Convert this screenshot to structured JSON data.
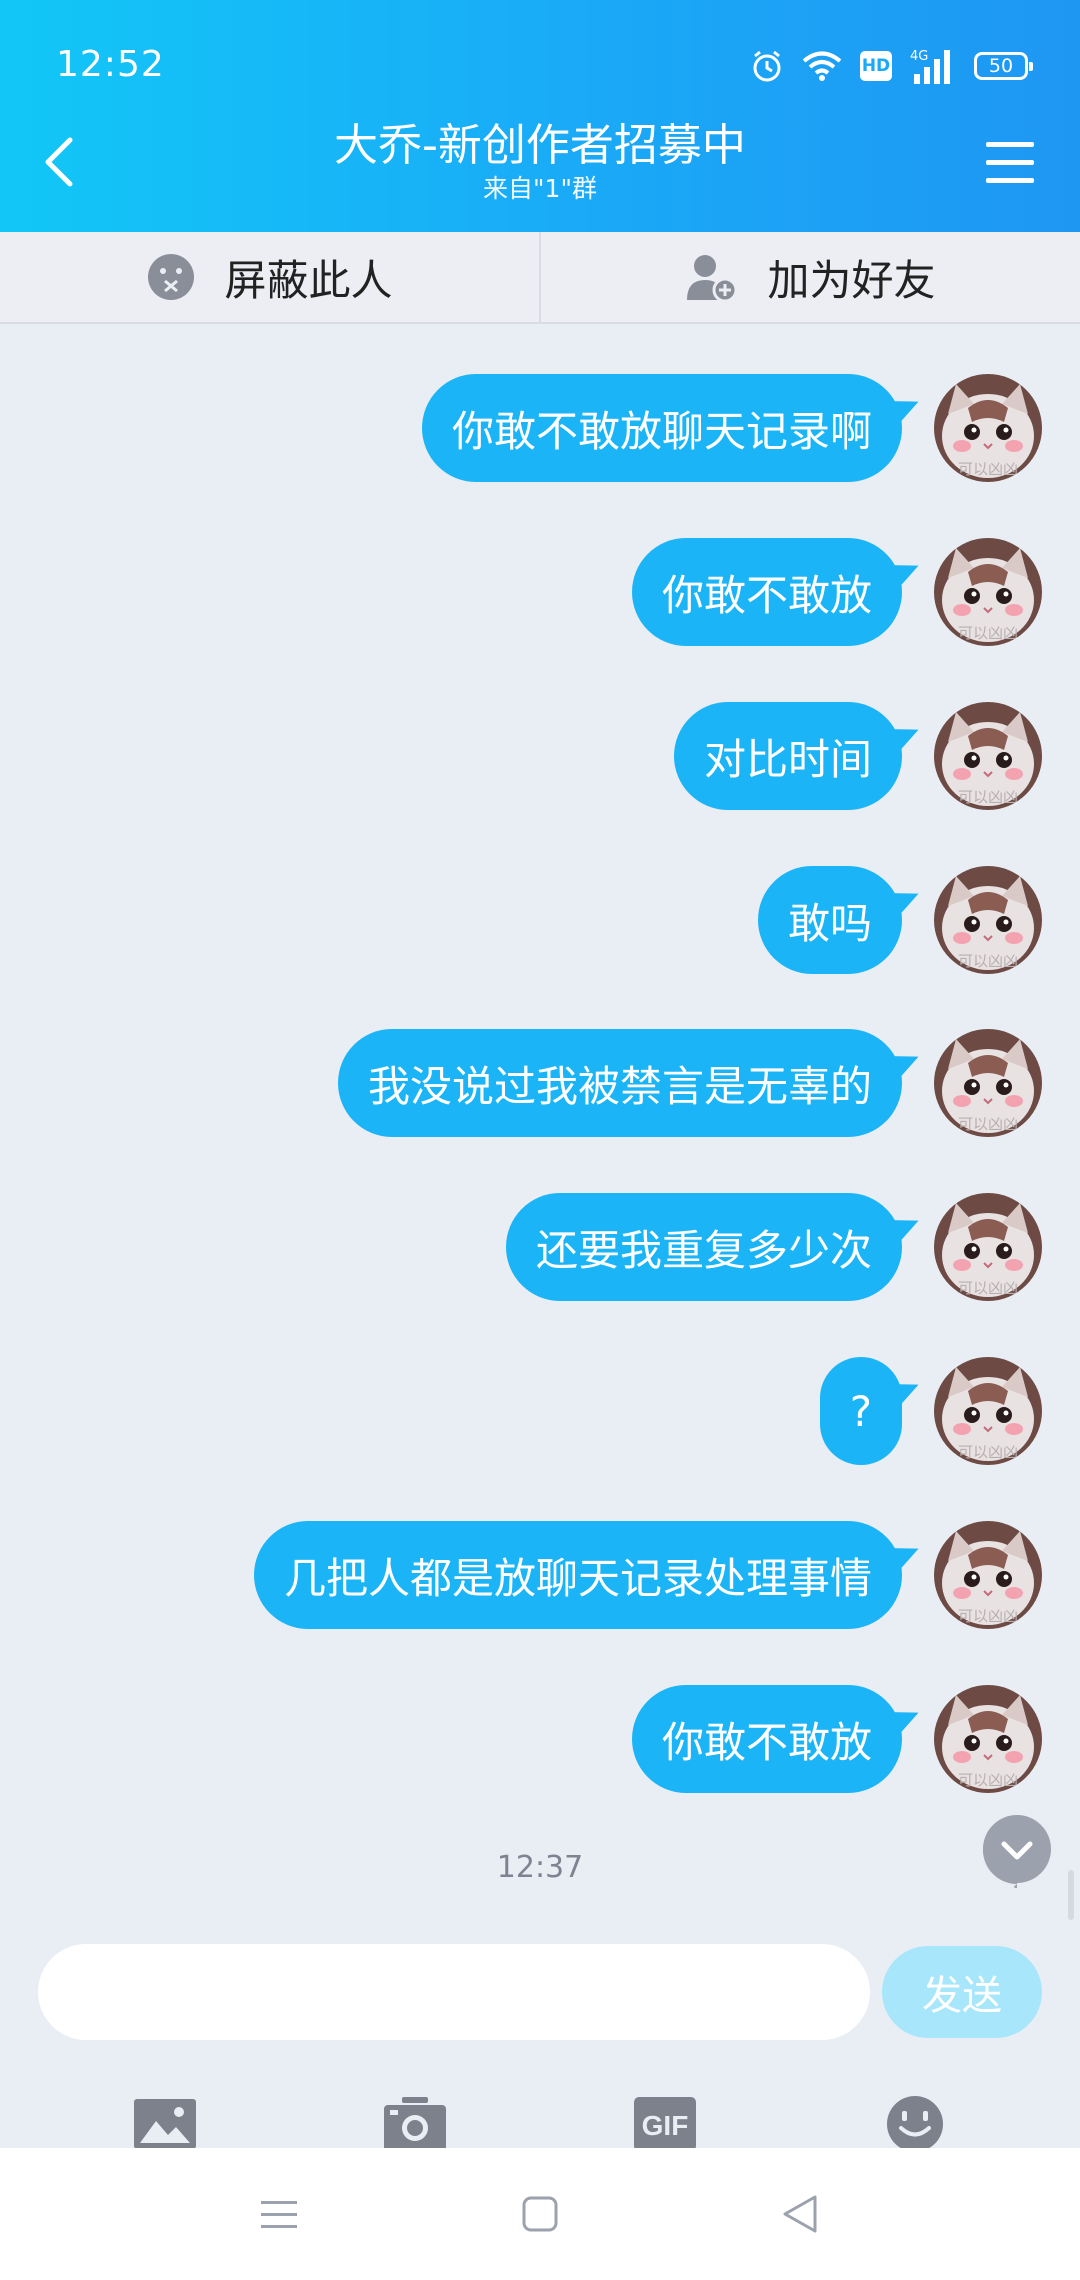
{
  "status_bar": {
    "time": "12:52",
    "hd": "HD",
    "network": "4G",
    "battery": "50"
  },
  "header": {
    "title": "大乔-新创作者招募中",
    "subtitle": "来自\"1\"群"
  },
  "actions": {
    "block": "屏蔽此人",
    "add_friend": "加为好友"
  },
  "messages": [
    {
      "text": "你敢不敢放聊天记录啊"
    },
    {
      "text": "你敢不敢放"
    },
    {
      "text": "对比时间"
    },
    {
      "text": "敢吗"
    },
    {
      "text": "我没说过我被禁言是无辜的"
    },
    {
      "text": "还要我重复多少次"
    },
    {
      "text": "?"
    },
    {
      "text": "几把人都是放聊天记录处理事情"
    },
    {
      "text": "你敢不敢放"
    }
  ],
  "timestamp": "12:37",
  "avatar_caption": "可以凶凶",
  "composer": {
    "input_value": "",
    "placeholder": "",
    "send_label": "发送"
  },
  "toolbar": {
    "gif_label": "GIF",
    "icons": [
      "image-icon",
      "camera-icon",
      "gif-icon",
      "emoji-icon"
    ]
  },
  "colors": {
    "header_start": "#12c7f7",
    "header_end": "#1e97f3",
    "bubble": "#1bb4f7",
    "send_disabled": "#a8e6fb",
    "background": "#e9edf4"
  }
}
